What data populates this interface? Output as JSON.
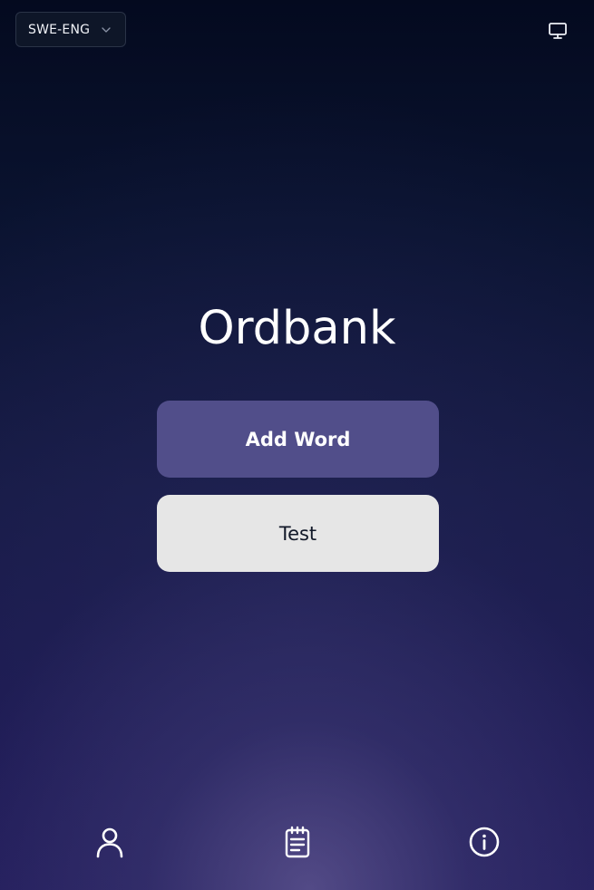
{
  "header": {
    "language_selector": {
      "value": "SWE-ENG",
      "icon": "chevron-down-icon"
    },
    "display_toggle_icon": "monitor-icon"
  },
  "main": {
    "title": "Ordbank",
    "add_word_label": "Add Word",
    "test_label": "Test"
  },
  "bottom_nav": {
    "items": [
      {
        "icon": "user-icon"
      },
      {
        "icon": "notepad-icon"
      },
      {
        "icon": "info-icon"
      }
    ]
  },
  "colors": {
    "add_button_bg": "#514e8a",
    "test_button_bg": "#e6e6e6",
    "background_top": "#040a1f",
    "background_bottom": "#231d5c"
  }
}
